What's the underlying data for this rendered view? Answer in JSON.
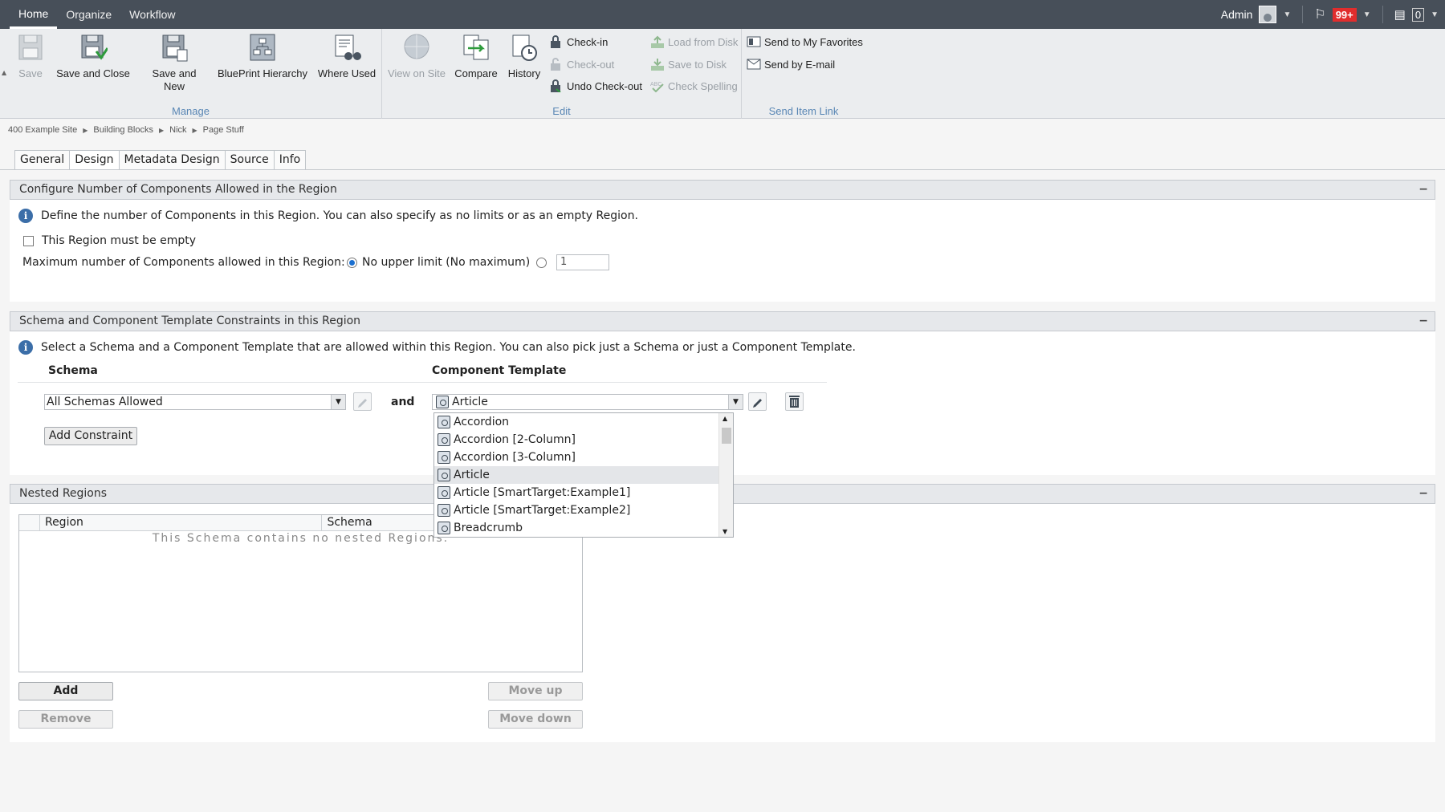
{
  "topbar": {
    "nav": [
      "Home",
      "Organize",
      "Workflow"
    ],
    "user": "Admin",
    "notifications_badge": "99+",
    "clipboard_count": "0"
  },
  "ribbon": {
    "manage": {
      "label": "Manage",
      "save": "Save",
      "save_close": "Save and Close",
      "save_new_line1": "Save and",
      "save_new_line2": "New",
      "blueprint": "BluePrint Hierarchy",
      "where_used": "Where Used"
    },
    "edit": {
      "label": "Edit",
      "view_on_site": "View on Site",
      "compare": "Compare",
      "history": "History",
      "check_in": "Check-in",
      "check_out": "Check-out",
      "undo_check_out": "Undo Check-out",
      "load_from_disk": "Load from Disk",
      "save_to_disk": "Save to Disk",
      "check_spelling": "Check Spelling"
    },
    "send": {
      "label": "Send Item Link",
      "favorites": "Send to My Favorites",
      "email": "Send by E-mail"
    }
  },
  "breadcrumb": [
    "400 Example Site",
    "Building Blocks",
    "Nick",
    "Page Stuff"
  ],
  "tabs": [
    "General",
    "Design",
    "Metadata Design",
    "Source",
    "Info"
  ],
  "panel_components": {
    "title": "Configure Number of Components Allowed in the Region",
    "info": "Define the number of Components in this Region. You can also specify as no limits or as an empty Region.",
    "empty_label": "This Region must be empty",
    "max_label": "Maximum number of Components allowed in this Region:",
    "no_limit_label": "No upper limit (No maximum)",
    "max_value": "1"
  },
  "panel_constraints": {
    "title": "Schema and Component Template Constraints in this Region",
    "info": "Select a Schema and a Component Template that are allowed within this Region. You can also pick just a Schema or just a Component Template.",
    "schema_header": "Schema",
    "ct_header": "Component Template",
    "schema_value": "All Schemas Allowed",
    "and_label": "and",
    "ct_value": "Article",
    "add_constraint": "Add Constraint",
    "dropdown_options": [
      "Accordion",
      "Accordion [2-Column]",
      "Accordion [3-Column]",
      "Article",
      "Article [SmartTarget:Example1]",
      "Article [SmartTarget:Example2]",
      "Breadcrumb"
    ],
    "selected_option": "Article"
  },
  "panel_nested": {
    "title": "Nested Regions",
    "col_region": "Region",
    "col_schema": "Schema",
    "empty_text": "This Schema contains no nested Regions.",
    "add": "Add",
    "remove": "Remove",
    "move_up": "Move up",
    "move_down": "Move down"
  }
}
